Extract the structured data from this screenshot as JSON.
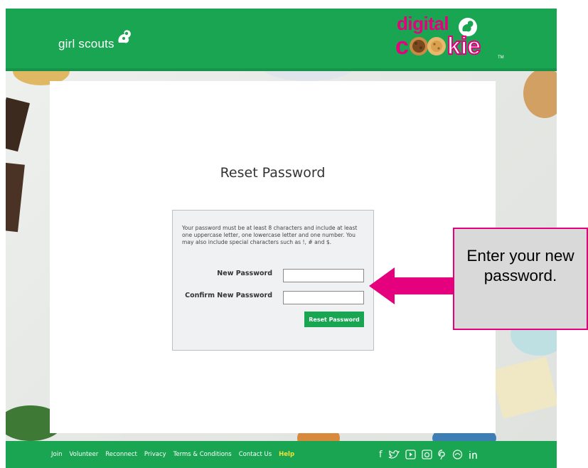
{
  "header": {
    "gs_logo_text": "girl scouts",
    "dc_logo_top": "digital",
    "dc_logo_c": "c",
    "dc_logo_kie": "kie",
    "dc_tm": "TM"
  },
  "reset": {
    "title": "Reset Password",
    "info": "Your password must be at least 8 characters and include at least one uppercase letter, one lowercase letter and one number. You may also include special characters such as !, # and $.",
    "new_password_label": "New Password",
    "new_password_value": "",
    "confirm_password_label": "Confirm New Password",
    "confirm_password_value": "",
    "button_label": "Reset Password"
  },
  "footer": {
    "links": [
      "Join",
      "Volunteer",
      "Reconnect",
      "Privacy",
      "Terms & Conditions",
      "Contact Us"
    ],
    "help": "Help",
    "social_icons": [
      "facebook-icon",
      "twitter-icon",
      "youtube-icon",
      "instagram-icon",
      "pinterest-icon",
      "blog-icon",
      "linkedin-icon"
    ]
  },
  "callout": {
    "text": "Enter your new password."
  },
  "colors": {
    "brand_green": "#1aa552",
    "accent_pink": "#e5007d",
    "help_yellow": "#f5e03b"
  }
}
